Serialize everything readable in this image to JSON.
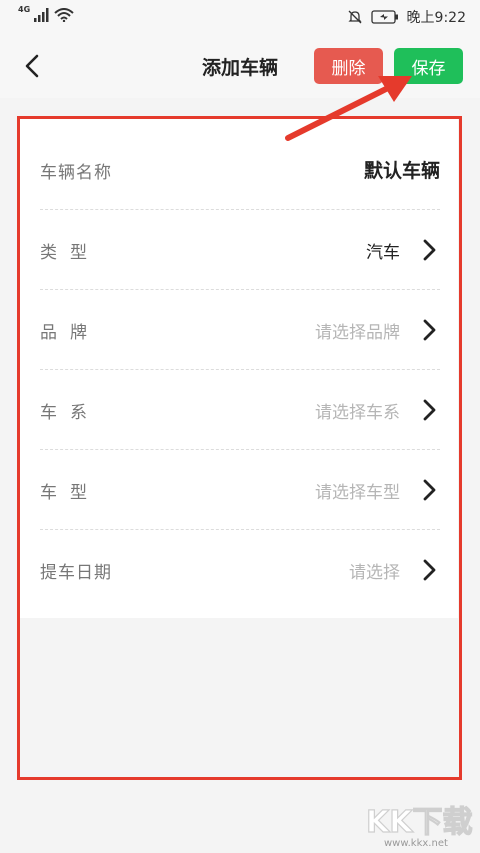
{
  "status_bar": {
    "network": "4G",
    "time": "晚上9:22"
  },
  "header": {
    "title": "添加车辆",
    "delete_label": "删除",
    "save_label": "保存"
  },
  "form": {
    "rows": [
      {
        "label": "车辆名称",
        "value": "默认车辆"
      },
      {
        "label": "类型",
        "value": "汽车"
      },
      {
        "label": "品牌",
        "placeholder": "请选择品牌"
      },
      {
        "label": "车系",
        "placeholder": "请选择车系"
      },
      {
        "label": "车型",
        "placeholder": "请选择车型"
      },
      {
        "label": "提车日期",
        "placeholder": "请选择"
      }
    ]
  },
  "watermark": {
    "text": "KK下载",
    "url": "www.kkx.net"
  },
  "colors": {
    "delete": "#e65a50",
    "save": "#1fbf5a",
    "annotation": "#e53a2c"
  },
  "icons": [
    "signal-icon",
    "wifi-icon",
    "mute-bell-icon",
    "battery-icon",
    "back-icon",
    "chevron-right-icon"
  ]
}
